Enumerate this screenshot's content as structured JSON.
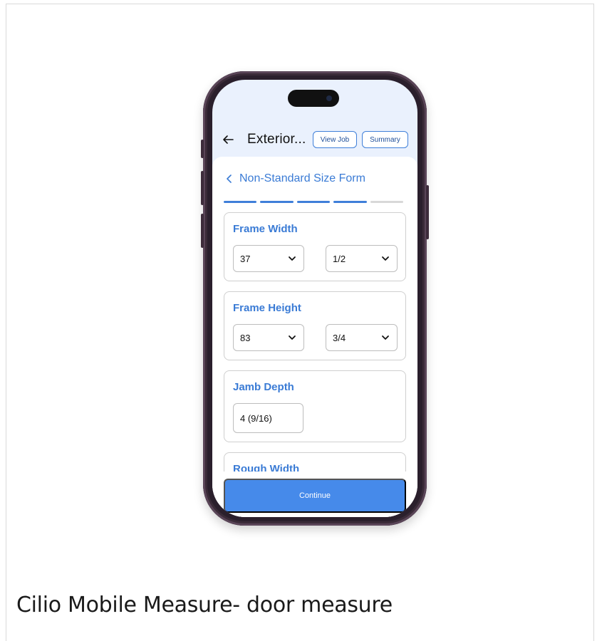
{
  "header": {
    "title": "Exterior...",
    "view_job_label": "View Job",
    "summary_label": "Summary"
  },
  "form": {
    "title": "Non-Standard Size Form",
    "steps_total": 5,
    "steps_completed": 4
  },
  "fields": {
    "frame_width": {
      "label": "Frame Width",
      "whole": "37",
      "fraction": "1/2"
    },
    "frame_height": {
      "label": "Frame Height",
      "whole": "83",
      "fraction": "3/4"
    },
    "jamb_depth": {
      "label": "Jamb Depth",
      "value": "4 (9/16)"
    },
    "rough_width": {
      "label": "Rough Width"
    }
  },
  "footer": {
    "continue_label": "Continue"
  },
  "caption": "Cilio Mobile Measure- door measure",
  "colors": {
    "accent": "#3a7bd5",
    "button": "#468aea",
    "header_bg": "#eaf1fd",
    "step_inactive": "#d8d8d8"
  }
}
